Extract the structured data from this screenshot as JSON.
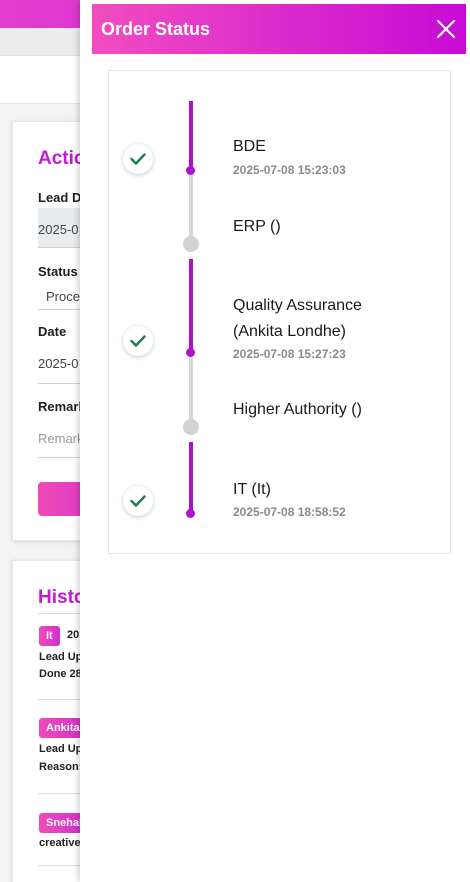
{
  "background": {
    "action_card": {
      "title": "Actio",
      "lead_date_label": "Lead D",
      "lead_date_value": "2025-0",
      "status_label": "Status",
      "status_value": "Proce",
      "date_label": "Date",
      "date_value": "2025-0",
      "remarks_label": "Remark",
      "remarks_placeholder": "Remark"
    },
    "history_card": {
      "title": "Histo",
      "entries": [
        {
          "tag": "It",
          "line1": "20",
          "line2": "Lead Up",
          "line3": "Done 28"
        },
        {
          "tag": "Ankita",
          "line1": "Lead Up",
          "line2": "Reason:"
        },
        {
          "tag": "Snehal",
          "line1": "creative"
        }
      ]
    }
  },
  "panel": {
    "title": "Order Status",
    "close_icon": "close-icon",
    "steps": [
      {
        "name": "BDE",
        "time": "2025-07-08 15:23:03",
        "done": true
      },
      {
        "name": "ERP ()",
        "time": "",
        "done": false
      },
      {
        "name": "Quality Assurance",
        "name_line2": "(Ankita Londhe)",
        "time": "2025-07-08 15:27:23",
        "done": true
      },
      {
        "name": "Higher Authority ()",
        "time": "",
        "done": false
      },
      {
        "name": "IT (It)",
        "time": "2025-07-08 18:58:52",
        "done": true
      }
    ]
  },
  "colors": {
    "accent": "#b10ecd",
    "header_gradient_start": "#f24dc0",
    "header_gradient_end": "#c70ad6",
    "check_green": "#1a7f4b",
    "inactive_gray": "#d6d6d6"
  }
}
